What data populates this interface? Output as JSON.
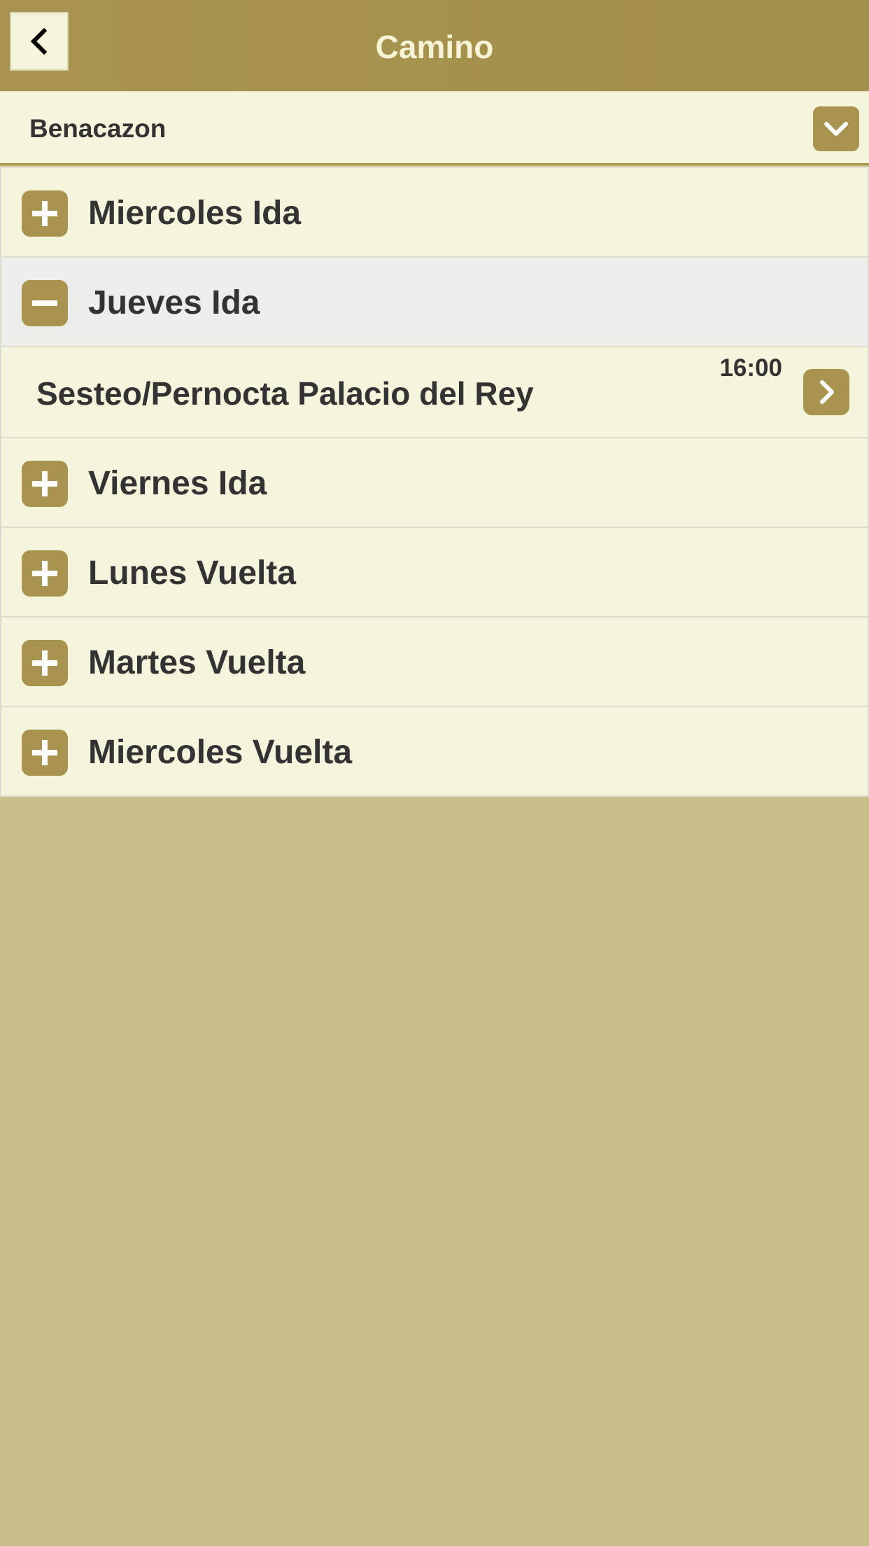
{
  "header": {
    "title": "Camino",
    "back_icon": "chevron-left-icon"
  },
  "selector": {
    "value": "Benacazon",
    "icon": "chevron-down-icon"
  },
  "colors": {
    "header_bg": "#a8944e",
    "title_text": "#f6f3d6",
    "row_bg": "#f5f5de",
    "expanded_row_bg": "#ededec",
    "page_bg": "#c8be89",
    "accent": "#a8944e"
  },
  "days": [
    {
      "label": "Miercoles Ida",
      "expanded": false,
      "icon": "plus-icon"
    },
    {
      "label": "Jueves Ida",
      "expanded": true,
      "icon": "minus-icon",
      "items": [
        {
          "label": "Sesteo/Pernocta Palacio del Rey",
          "time": "16:00",
          "icon": "chevron-right-icon"
        }
      ]
    },
    {
      "label": "Viernes Ida",
      "expanded": false,
      "icon": "plus-icon"
    },
    {
      "label": "Lunes Vuelta",
      "expanded": false,
      "icon": "plus-icon"
    },
    {
      "label": "Martes Vuelta",
      "expanded": false,
      "icon": "plus-icon"
    },
    {
      "label": "Miercoles Vuelta",
      "expanded": false,
      "icon": "plus-icon"
    }
  ]
}
